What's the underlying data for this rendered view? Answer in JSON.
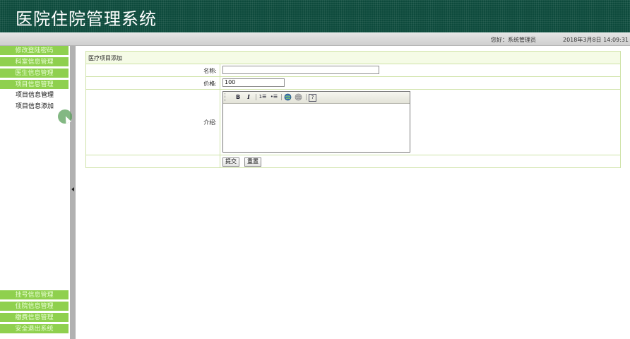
{
  "header": {
    "title": "医院住院管理系统"
  },
  "statusbar": {
    "greeting": "您好：系统管理员",
    "datetime": "2018年3月8日 14:09:31"
  },
  "sidebar": {
    "top_items": [
      "修改登陆密码",
      "科室信息管理",
      "医生信息管理",
      "项目信息管理"
    ],
    "sub_items": [
      "项目信息管理",
      "项目信息添加"
    ],
    "bottom_items": [
      "挂号信息管理",
      "住院信息管理",
      "缴费信息管理",
      "安全退出系统"
    ]
  },
  "form": {
    "title": "医疗项目添加",
    "name_label": "名称:",
    "name_value": "",
    "price_label": "价格:",
    "price_value": "100",
    "intro_label": "介绍:",
    "submit_label": "提交",
    "reset_label": "重置"
  },
  "editor_toolbar": {
    "bold": "B",
    "italic": "I",
    "ordered_list": "1☰",
    "unordered_list": "•☰",
    "help": "?"
  },
  "colors": {
    "header_bg": "#0d4a3c",
    "menu_bg": "#8fd04e",
    "panel_border": "#cfe3a8",
    "panel_title_bg": "#f5fbe6"
  }
}
